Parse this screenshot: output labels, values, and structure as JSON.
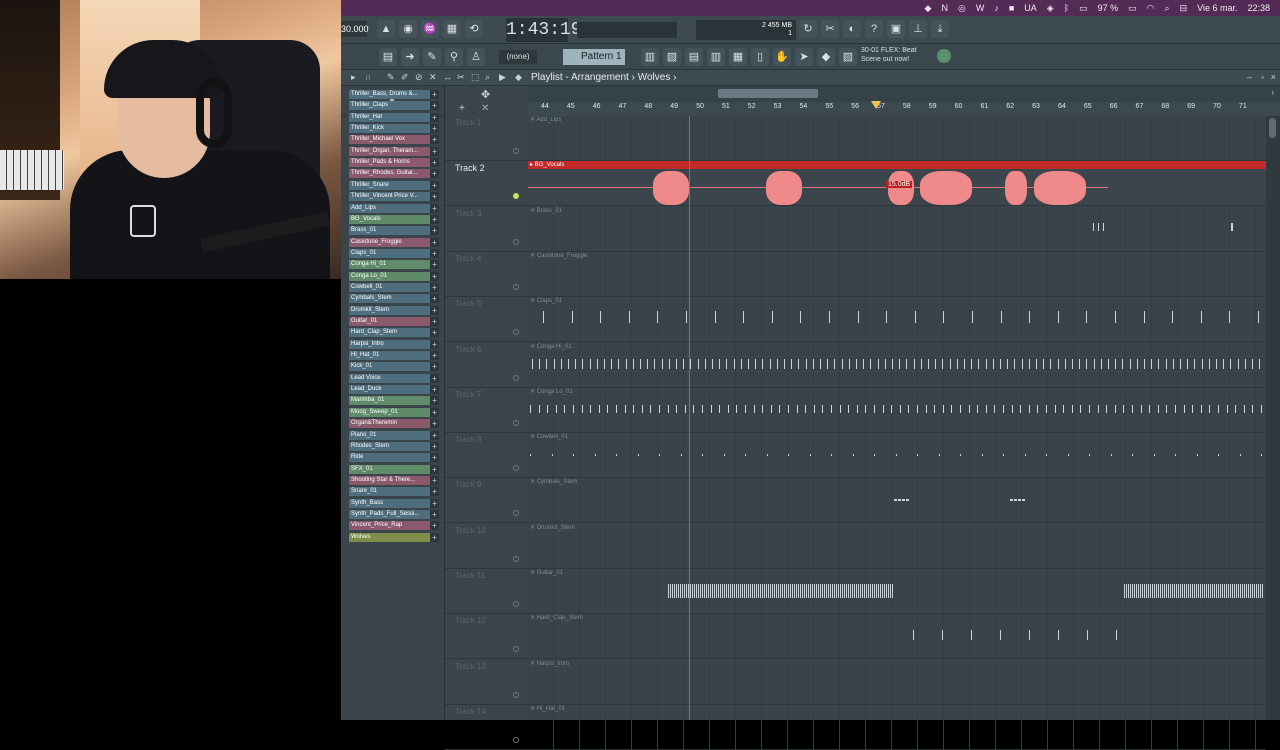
{
  "menubar": {
    "items": [
      "UA",
      "97 %",
      "Vie 6 mar.",
      "22:38"
    ],
    "battery": "97 %",
    "date": "Vie 6 mar.",
    "clock": "22:38"
  },
  "toolbar": {
    "tempo": "30.000",
    "time": "1:43:19",
    "cpu_label": "2  455 MB",
    "cpu_sub": "1",
    "pattern_select": "(none)",
    "pattern": "Pattern 1",
    "hint_line1": "30-01 FLEX: Beat",
    "hint_line2": "Scene out now!"
  },
  "window": {
    "breadcrumb": "Playlist - Arrangement",
    "project": "Wolves",
    "breadcrumb_sep": "›"
  },
  "ruler": {
    "bars": [
      "44",
      "45",
      "46",
      "47",
      "48",
      "49",
      "50",
      "51",
      "52",
      "53",
      "54",
      "55",
      "56",
      "57",
      "58",
      "59",
      "60",
      "61",
      "62",
      "63",
      "64",
      "65",
      "66",
      "67",
      "68",
      "69",
      "70",
      "71"
    ]
  },
  "clips": [
    {
      "name": "Thriller_Bass, Drums &...",
      "color": "#4f6e7d"
    },
    {
      "name": "Thriller_Claps",
      "color": "#4f6e7d"
    },
    {
      "name": "Thriller_Hat",
      "color": "#4f6e7d"
    },
    {
      "name": "Thriller_Kick",
      "color": "#4f6e7d"
    },
    {
      "name": "Thriller_Michael Vox",
      "color": "#8a5a6c"
    },
    {
      "name": "Thriller_Organ, Theram...",
      "color": "#8a5a6c"
    },
    {
      "name": "Thriller_Pads & Horns",
      "color": "#8a5a6c"
    },
    {
      "name": "Thriller_Rhodes, Guitar...",
      "color": "#8a5a6c"
    },
    {
      "name": "Thriller_Snare",
      "color": "#4f6e7d"
    },
    {
      "name": "Thriller_Vincent Price V...",
      "color": "#4f6e7d"
    },
    {
      "name": "Add_Lips",
      "color": "#4f6e7d"
    },
    {
      "name": "BG_Vocals",
      "color": "#5f8b69"
    },
    {
      "name": "Brass_01",
      "color": "#4f6e7d"
    },
    {
      "name": "Casiotone_Froggie",
      "color": "#8a5a6c"
    },
    {
      "name": "Claps_01",
      "color": "#4f6e7d"
    },
    {
      "name": "Conga Hi_01",
      "color": "#5f8b69"
    },
    {
      "name": "Conga Lo_01",
      "color": "#5f8b69"
    },
    {
      "name": "Cowbell_01",
      "color": "#4f6e7d"
    },
    {
      "name": "Cymbals_Stem",
      "color": "#4f6e7d"
    },
    {
      "name": "Drumkit_Stem",
      "color": "#4f6e7d"
    },
    {
      "name": "Guitar_01",
      "color": "#8a5a6c"
    },
    {
      "name": "Hard_Clap_Stem",
      "color": "#4f6e7d"
    },
    {
      "name": "Harpsi_Intro",
      "color": "#4f6e7d"
    },
    {
      "name": "Hi_Hat_01",
      "color": "#4f6e7d"
    },
    {
      "name": "Kick_01",
      "color": "#4f6e7d"
    },
    {
      "name": "Lead Voice",
      "color": "#4f6e7d"
    },
    {
      "name": "Lead_Duck",
      "color": "#4f6e7d"
    },
    {
      "name": "Marimba_01",
      "color": "#5f8b69"
    },
    {
      "name": "Moog_Sweep_01",
      "color": "#5f8b69"
    },
    {
      "name": "Organ&Theremin",
      "color": "#8a5a6c"
    },
    {
      "name": "Piano_01",
      "color": "#4f6e7d"
    },
    {
      "name": "Rhodes_Stem",
      "color": "#4f6e7d"
    },
    {
      "name": "Ride",
      "color": "#4f6e7d"
    },
    {
      "name": "SFX_01",
      "color": "#5f8b69"
    },
    {
      "name": "Shooting Star & There...",
      "color": "#8a5a6c"
    },
    {
      "name": "Snare_01",
      "color": "#4f6e7d"
    },
    {
      "name": "Synth_Bass",
      "color": "#4f6e7d"
    },
    {
      "name": "Synth_Pads_Full_Sessi...",
      "color": "#4f6e7d"
    },
    {
      "name": "Vincent_Price_Rap",
      "color": "#8a5a6c"
    },
    {
      "name": "Wolves",
      "color": "#7e8d4a"
    }
  ],
  "tracks": [
    {
      "label": "Track 1",
      "clip": "Add_Lips"
    },
    {
      "label": "Track 2",
      "clip": "BG_Vocals"
    },
    {
      "label": "Track 3",
      "clip": "Brass_01"
    },
    {
      "label": "Track 4",
      "clip": "Casiotone_Froggie"
    },
    {
      "label": "Track 5",
      "clip": "Claps_01"
    },
    {
      "label": "Track 6",
      "clip": "Conga Hi_01"
    },
    {
      "label": "Track 7",
      "clip": "Conga Lo_01"
    },
    {
      "label": "Track 8",
      "clip": "Cowbell_01"
    },
    {
      "label": "Track 9",
      "clip": "Cymbals_Stem"
    },
    {
      "label": "Track 10",
      "clip": "Drumkit_Stem"
    },
    {
      "label": "Track 11",
      "clip": "Guitar_01"
    },
    {
      "label": "Track 12",
      "clip": "Hard_Clap_Stem"
    },
    {
      "label": "Track 13",
      "clip": "Harpsi_Intro"
    },
    {
      "label": "Track 14",
      "clip": "Hi_Hat_01"
    }
  ],
  "gain_badge": "15.0dB",
  "colors": {
    "accent": "#c42a2a",
    "menubar": "#542b56"
  }
}
